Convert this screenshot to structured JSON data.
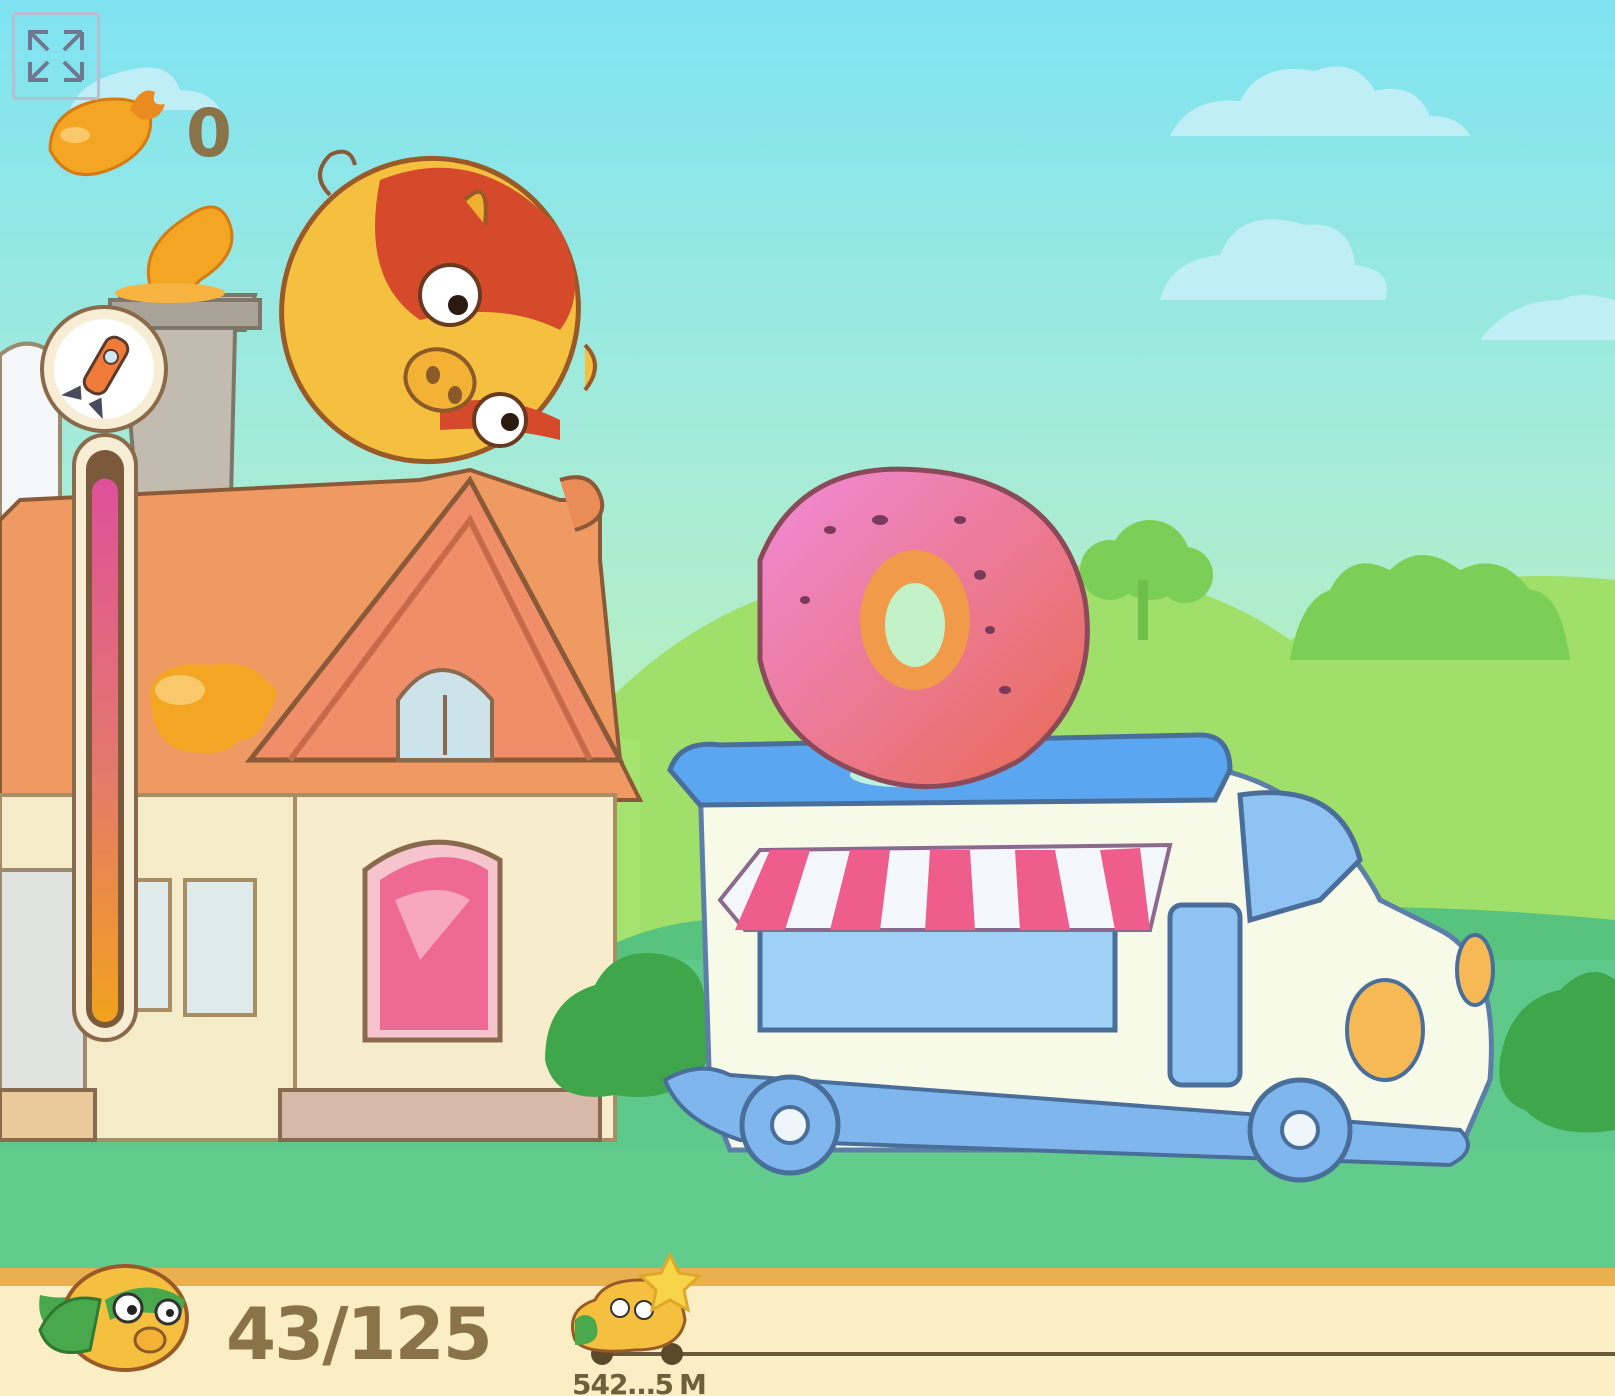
{
  "hud": {
    "mango_count": "0",
    "pig_count": "43/125",
    "distance_value": "542…5",
    "distance_unit": "M",
    "power_meter_level": 0.96
  },
  "icons": {
    "fullscreen": "fullscreen-icon",
    "mango": "mango-icon",
    "rocket": "rocket-icon",
    "pig_avatar": "pig-avatar-icon",
    "star": "star-icon"
  },
  "colors": {
    "sky_top": "#7fe3f2",
    "grass": "#5ec98a",
    "ground_bar": "#fbeec4",
    "hud_text": "#8a7348",
    "meter_pink": "#e0509a",
    "meter_orange": "#f2a21e"
  }
}
